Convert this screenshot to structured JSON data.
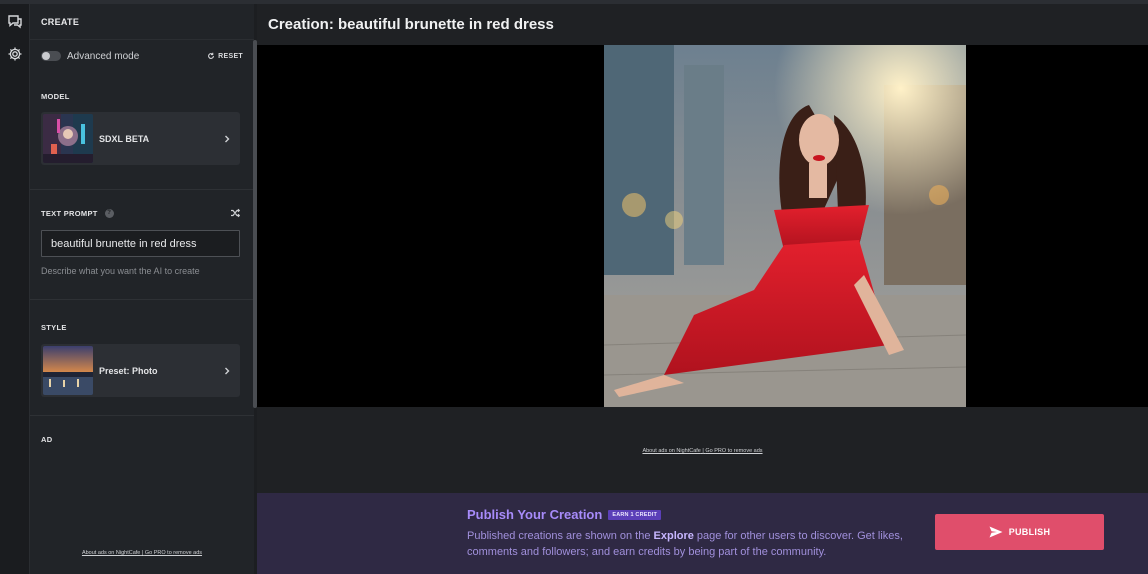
{
  "sidebar": {
    "header": "CREATE",
    "advanced_mode_label": "Advanced mode",
    "advanced_mode_on": false,
    "reset_label": "RESET",
    "model": {
      "section": "MODEL",
      "name": "SDXL BETA"
    },
    "prompt": {
      "section": "TEXT PROMPT",
      "help": "?",
      "value": "beautiful brunette in red dress",
      "hint": "Describe what you want the AI to create"
    },
    "style": {
      "section": "STYLE",
      "name": "Preset: Photo"
    },
    "ad": {
      "section": "AD",
      "about_link": "About ads on NightCafe",
      "separator": "|",
      "pro_link": "Go PRO to remove ads"
    }
  },
  "main": {
    "title": "Creation: beautiful brunette in red dress",
    "ad": {
      "about_link": "About ads on NightCafe",
      "separator": "|",
      "pro_link": "Go PRO to remove ads"
    }
  },
  "publish": {
    "title": "Publish Your Creation",
    "badge": "EARN 1 CREDIT",
    "desc_before": "Published creations are shown on the ",
    "desc_bold": "Explore",
    "desc_after": " page for other users to discover. Get likes, comments and followers; and earn credits by being part of the community.",
    "button": "PUBLISH"
  },
  "colors": {
    "accent": "#a78bfa",
    "publish_button": "#e04e6b",
    "badge": "#5b3fb8"
  },
  "icons": [
    "chat-icon",
    "gear-icon",
    "refresh-icon",
    "chevron-right-icon",
    "shuffle-icon",
    "help-icon",
    "send-icon"
  ]
}
